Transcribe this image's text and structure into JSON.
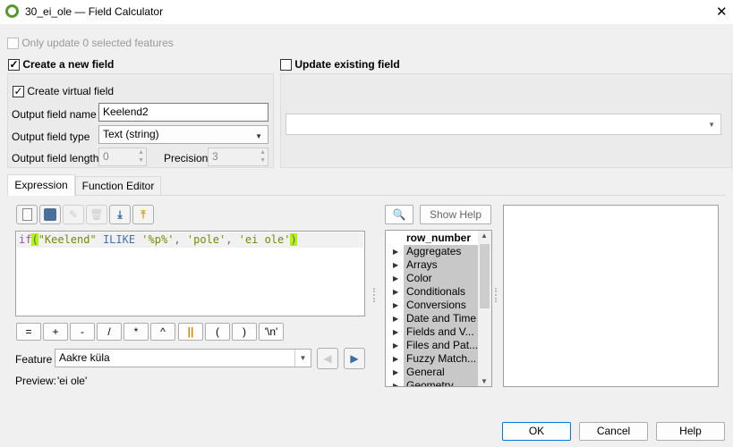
{
  "window": {
    "title": "30_ei_ole — Field Calculator",
    "close": "✕"
  },
  "only_update": {
    "label": "Only update 0 selected features",
    "checked": false
  },
  "create_new": {
    "label": "Create a new field",
    "checked": true
  },
  "update_existing": {
    "label": "Update existing field",
    "checked": false
  },
  "virtual": {
    "label": "Create virtual field",
    "checked": true
  },
  "fields": {
    "name_label": "Output field name",
    "name_value": "Keelend2",
    "type_label": "Output field type",
    "type_value": "Text (string)",
    "length_label": "Output field length",
    "length_value": "0",
    "precision_label": "Precision",
    "precision_value": "3"
  },
  "tabs": [
    {
      "label": "Expression",
      "active": true
    },
    {
      "label": "Function Editor",
      "active": false
    }
  ],
  "expression": {
    "t1": "if",
    "t2": "(",
    "t3": "\"Keelend\"",
    "t4": " ILIKE ",
    "t5": "'%p%'",
    "t6": ", ",
    "t7": "'pole'",
    "t8": ", ",
    "t9": "'ei ole'",
    "t10": ")"
  },
  "operators": [
    "=",
    "+",
    "-",
    "/",
    "*",
    "^",
    "||",
    "(",
    ")",
    "'\\n'"
  ],
  "feature": {
    "label": "Feature",
    "value": "Aakre küla"
  },
  "preview": {
    "label": "Preview:",
    "value": "'ei ole'"
  },
  "show_help": "Show Help",
  "tree": [
    "row_number",
    "Aggregates",
    "Arrays",
    "Color",
    "Conditionals",
    "Conversions",
    "Date and Time",
    "Fields and V...",
    "Files and Pat...",
    "Fuzzy Match...",
    "General",
    "Geometry"
  ],
  "buttons": {
    "ok": "OK",
    "cancel": "Cancel",
    "help": "Help"
  },
  "colors": {
    "keyword": "#8959a8",
    "string": "#718c00",
    "operator": "#4271ae",
    "bracket_highlight": "#b7f300"
  }
}
